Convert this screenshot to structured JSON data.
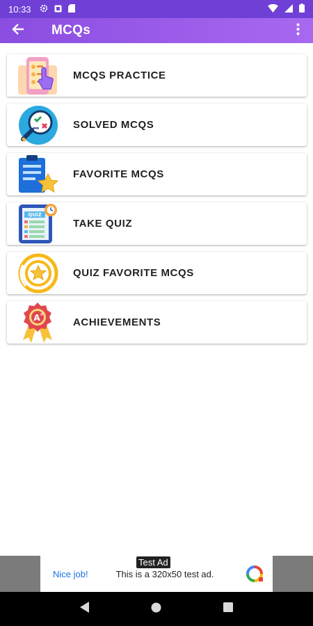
{
  "status_bar": {
    "time": "10:33"
  },
  "app_bar": {
    "title": "MCQs"
  },
  "menu_items": [
    {
      "label": "MCQS PRACTICE",
      "icon": "touch-screen-icon"
    },
    {
      "label": "SOLVED MCQS",
      "icon": "magnifier-check-icon"
    },
    {
      "label": "FAVORITE MCQS",
      "icon": "clipboard-star-icon"
    },
    {
      "label": "TAKE QUIZ",
      "icon": "quiz-tablet-icon"
    },
    {
      "label": "QUIZ FAVORITE MCQS",
      "icon": "star-badge-icon"
    },
    {
      "label": "ACHIEVEMENTS",
      "icon": "award-ribbon-icon"
    }
  ],
  "ad": {
    "tag": "Test Ad",
    "cta": "Nice job!",
    "text": "This is a 320x50 test ad."
  },
  "colors": {
    "status_bar": "#6f3fd6",
    "app_bar": "#9a5ce8",
    "ad_background": "#7b7b7b",
    "nav_bar": "#000000"
  }
}
